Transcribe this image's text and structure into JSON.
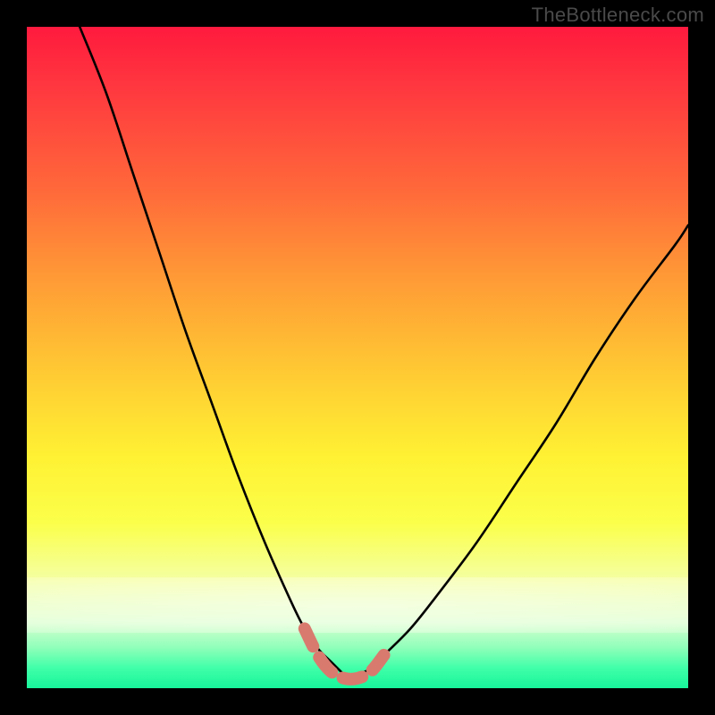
{
  "watermark": "TheBottleneck.com",
  "colors": {
    "background": "#000000",
    "curve_stroke": "#000000",
    "trough_stroke": "#d97a6e",
    "gradient_top": "#ff1a3e",
    "gradient_bottom": "#17f59b"
  },
  "chart_data": {
    "type": "line",
    "title": "",
    "xlabel": "",
    "ylabel": "",
    "xlim": [
      0,
      100
    ],
    "ylim": [
      0,
      100
    ],
    "series": [
      {
        "name": "left-curve",
        "x": [
          8,
          12,
          16,
          20,
          24,
          28,
          32,
          36,
          40,
          42,
          44,
          46,
          48
        ],
        "y": [
          100,
          90,
          78,
          66,
          54,
          43,
          32,
          22,
          13,
          9,
          6,
          4,
          2
        ]
      },
      {
        "name": "trough",
        "x": [
          42,
          44,
          46,
          48,
          50,
          52,
          54
        ],
        "y": [
          9,
          5,
          2.5,
          1.5,
          1.5,
          2.5,
          5
        ]
      },
      {
        "name": "right-curve",
        "x": [
          50,
          52,
          54,
          58,
          62,
          68,
          74,
          80,
          86,
          92,
          98,
          100
        ],
        "y": [
          2,
          3,
          5,
          9,
          14,
          22,
          31,
          40,
          50,
          59,
          67,
          70
        ]
      }
    ],
    "annotations": [
      {
        "text": "TheBottleneck.com",
        "position": "top-right"
      }
    ]
  }
}
